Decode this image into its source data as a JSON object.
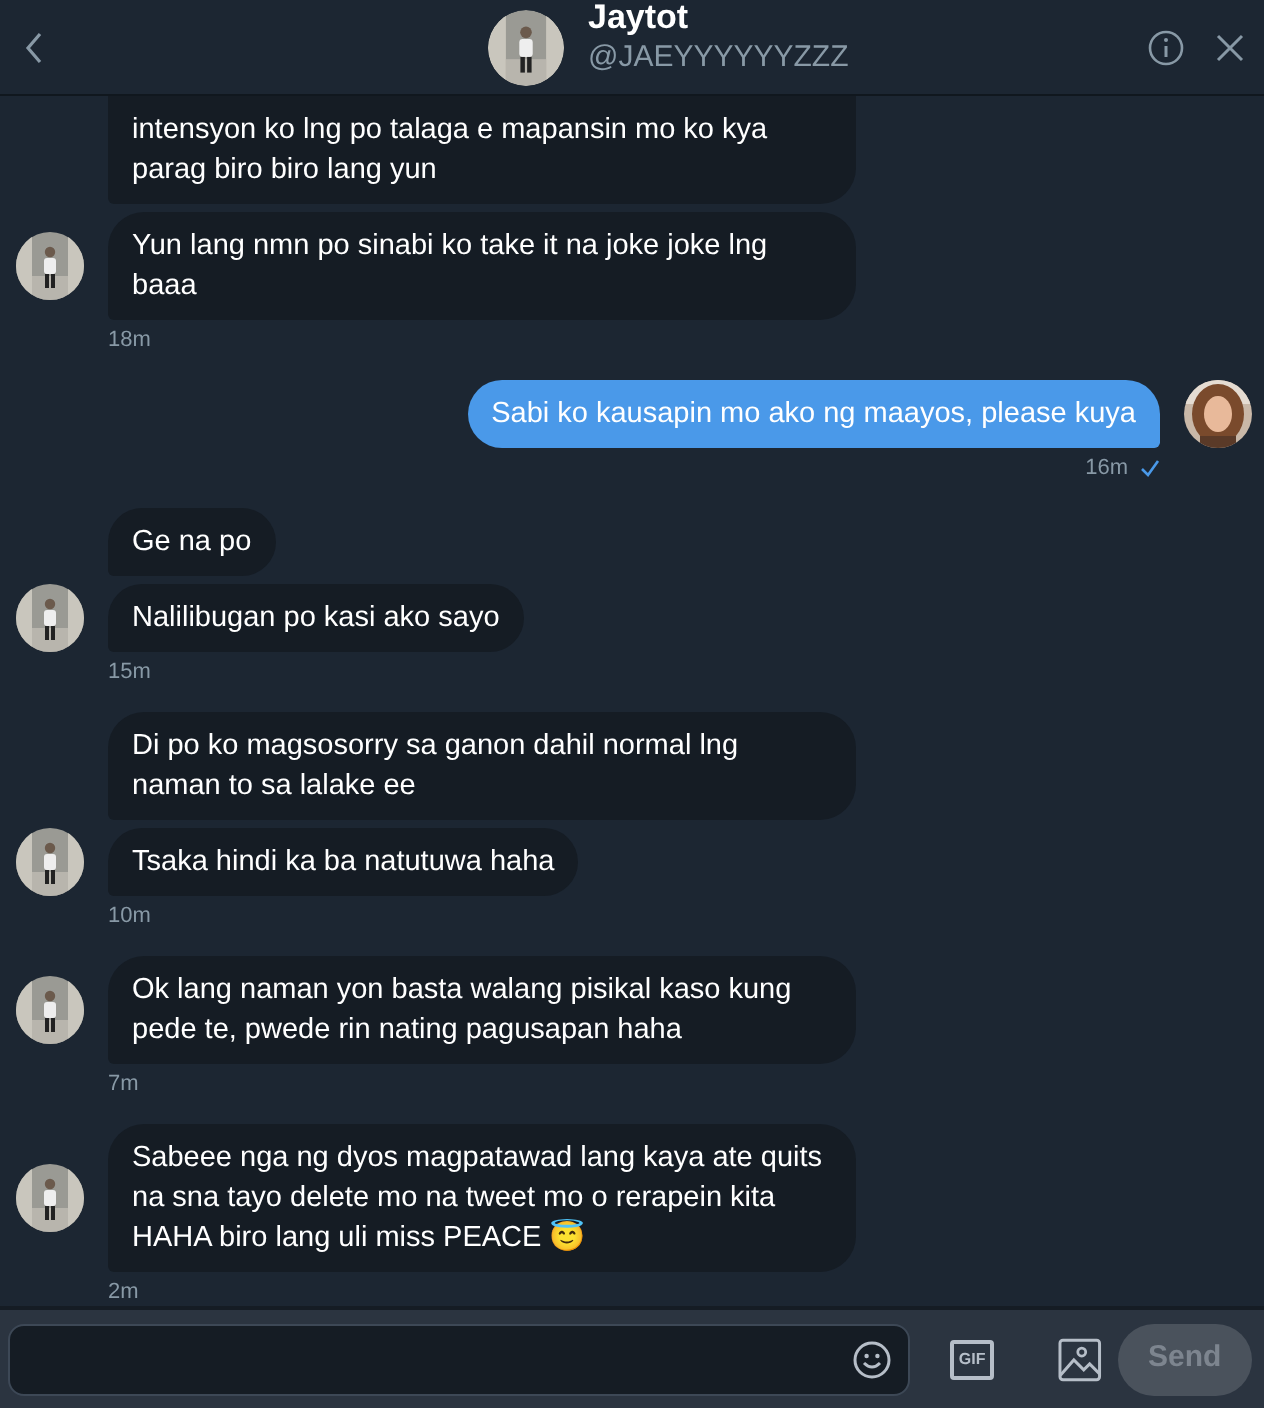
{
  "header": {
    "name": "Jaytot",
    "handle": "@JAEYYYYYYZZZ"
  },
  "groups": [
    {
      "kind": "received",
      "bubbles": [
        "intensyon ko lng po talaga e mapansin mo ko kya parag biro biro lang yun",
        "Yun lang nmn po sinabi ko take it na joke joke lng baaa"
      ],
      "time": "18m"
    },
    {
      "kind": "sent",
      "bubbles": [
        "Sabi ko kausapin mo ako ng maayos, please kuya"
      ],
      "time": "16m",
      "seen": true
    },
    {
      "kind": "received",
      "bubbles": [
        "Ge na po",
        "Nalilibugan po kasi ako sayo"
      ],
      "time": "15m"
    },
    {
      "kind": "received",
      "bubbles": [
        "Di po ko magsosorry sa ganon dahil normal lng naman to sa lalake ee",
        "Tsaka hindi ka ba natutuwa haha"
      ],
      "time": "10m"
    },
    {
      "kind": "received",
      "bubbles": [
        "Ok lang naman yon basta walang pisikal kaso kung pede te, pwede rin nating pagusapan haha"
      ],
      "time": "7m"
    },
    {
      "kind": "received",
      "bubbles": [
        "Sabeee nga ng dyos magpatawad lang kaya ate quits na sna tayo delete mo na tweet mo o rerapein kita HAHA biro lang uli miss PEACE 😇"
      ],
      "time": "2m"
    }
  ],
  "composer": {
    "gif_label": "GIF",
    "send": {
      "label": "Send",
      "disabled": true
    }
  }
}
